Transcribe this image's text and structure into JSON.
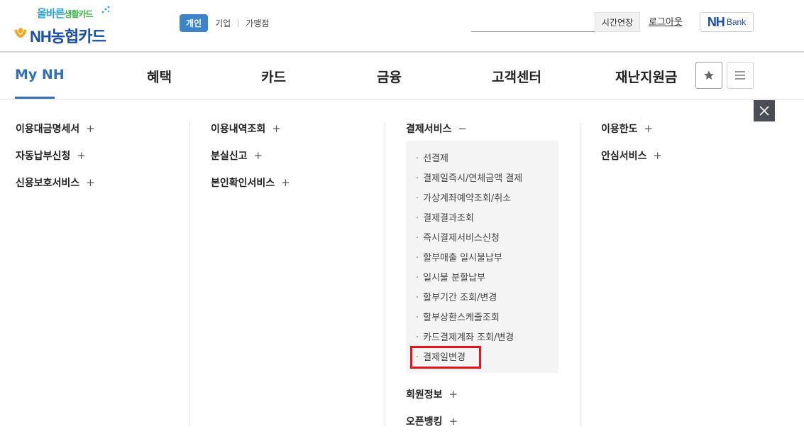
{
  "logo": {
    "tagline": "올바른",
    "tagline_accent": "생활카드",
    "brand": "NH농협카드"
  },
  "segments": {
    "active": "개인",
    "items": [
      "기업",
      "가맹점"
    ]
  },
  "header": {
    "search_value": "",
    "extend_label": "시간연장",
    "logout_label": "로그아웃",
    "nhbank_mark": "NH",
    "nhbank_text": "Bank"
  },
  "gnb": {
    "items": [
      "My NH",
      "혜택",
      "카드",
      "금융",
      "고객센터",
      "재난지원금"
    ],
    "active_index": 0
  },
  "mega": {
    "col1": [
      "이용대금명세서",
      "자동납부신청",
      "신용보호서비스"
    ],
    "col2": [
      "이용내역조회",
      "분실신고",
      "본인확인서비스"
    ],
    "col3_open": "결제서비스",
    "col3_sub": [
      "선결제",
      "결제일즉시/연체금액 결제",
      "가상계좌예약조회/취소",
      "결제결과조회",
      "즉시결제서비스신청",
      "할부매출 일시불납부",
      "일시불 분할납부",
      "할부기간 조회/변경",
      "할부상환스케줄조회",
      "카드결제계좌 조회/변경",
      "결제일변경"
    ],
    "col3_after": [
      "회원정보",
      "오픈뱅킹"
    ],
    "col4": [
      "이용한도",
      "안심서비스"
    ],
    "plus_symbol": "+",
    "minus_symbol": "−",
    "bullet": "·"
  },
  "colors": {
    "brand_blue": "#1a4ea0",
    "active_blue": "#2f6fb6",
    "segment_blue": "#3b84c8",
    "highlight_red": "#e0161c"
  }
}
